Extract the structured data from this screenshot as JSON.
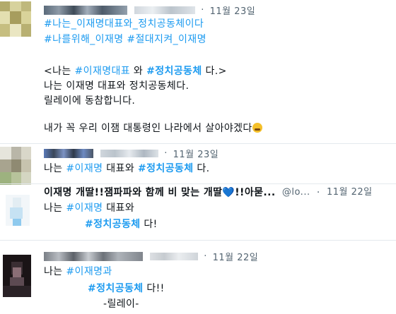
{
  "colors": {
    "accent": "#1d9bf0",
    "text": "#0f1419",
    "muted": "#536471"
  },
  "posts": [
    {
      "date": "11월 23일",
      "lines": [
        {
          "tag": "#나는_이재명대표와_정치공동체이다"
        },
        {
          "tag1": "#나를위해_이재명",
          "tag2": "#절대지켜_이재명"
        },
        {
          "pre": "<나는 ",
          "tag": "#이재명대표",
          "mid": " 와 ",
          "tag_bold": "#정치공동체",
          "post": " 다.>"
        },
        {
          "text": "나는 이재명 대표와 정치공동체다."
        },
        {
          "text": "릴레이에 동참합니다."
        },
        {
          "text": "내가 꼭 우리 이잼 대통령인 나라에서 살아야겠다",
          "emoji": "crying-face-icon"
        }
      ]
    },
    {
      "date": "11월 23일",
      "line": {
        "pre": "나는 ",
        "tag": "#이재명",
        "mid": " 대표와 ",
        "tag_bold": "#정치공동체",
        "post": " 다."
      }
    },
    {
      "title": {
        "text": "이재명 개딸!!잼파파와 함께 비 맞는 개딸",
        "heart": "💙",
        "suffix": "!!아묻...",
        "handle": "@lo...",
        "date": "11월 22일"
      },
      "line1": {
        "pre": "나는 ",
        "tag": "#이재명",
        "post": " 대표와"
      },
      "line2": {
        "tag_bold": "#정치공동체",
        "post": " 다!"
      }
    },
    {
      "date": "11월 22일",
      "line1": {
        "pre": "나는 ",
        "tag": "#이재명과"
      },
      "line2": {
        "tag_bold": "#정치공동체",
        "post": " 다!!"
      },
      "line3": {
        "text": "-릴레이-"
      }
    }
  ]
}
